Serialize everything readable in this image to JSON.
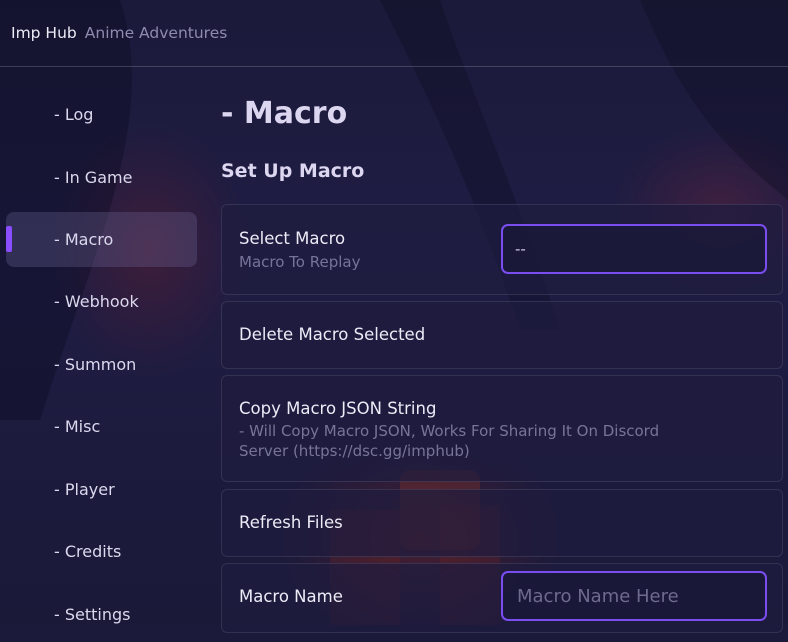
{
  "header": {
    "title": "Imp Hub",
    "game": "Anime Adventures"
  },
  "sidebar": {
    "items": [
      {
        "label": "- Log"
      },
      {
        "label": "- In Game"
      },
      {
        "label": "- Macro",
        "active": true
      },
      {
        "label": "- Webhook"
      },
      {
        "label": "- Summon"
      },
      {
        "label": "- Misc"
      },
      {
        "label": "- Player"
      },
      {
        "label": "- Credits"
      },
      {
        "label": "- Settings"
      }
    ]
  },
  "main": {
    "page_title": "- Macro",
    "section_title": "Set Up Macro",
    "select_macro": {
      "title": "Select Macro",
      "subtitle": "Macro To Replay",
      "value": "--"
    },
    "delete_macro": {
      "title": "Delete Macro Selected"
    },
    "copy_macro": {
      "title": "Copy Macro JSON String",
      "subtitle_line1": "- Will Copy Macro JSON, Works For Sharing It On Discord",
      "subtitle_line2": "Server (https://dsc.gg/imphub)"
    },
    "refresh_files": {
      "title": "Refresh Files"
    },
    "macro_name": {
      "title": "Macro Name",
      "placeholder": "Macro Name Here"
    }
  },
  "colors": {
    "accent": "#8a4dff",
    "background": "#1d1b40"
  }
}
